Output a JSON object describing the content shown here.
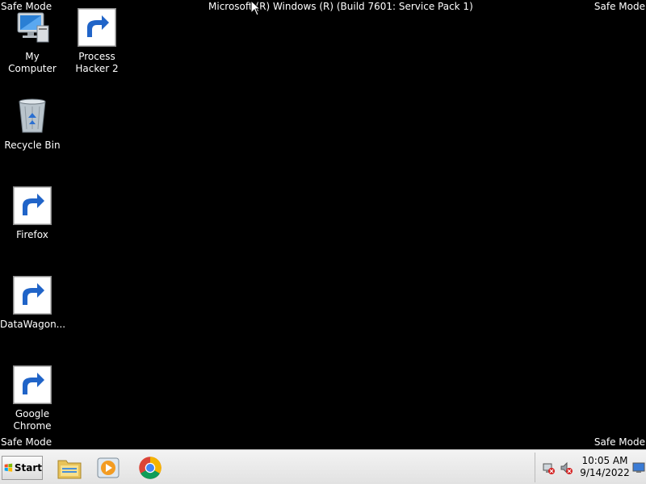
{
  "watermark": {
    "safe_mode": "Safe Mode",
    "build": "Microsoft (R) Windows (R) (Build 7601: Service Pack 1)"
  },
  "desktop": {
    "icons": [
      {
        "name": "my-computer",
        "label": "My Computer"
      },
      {
        "name": "process-hacker",
        "label": "Process Hacker 2"
      },
      {
        "name": "recycle-bin",
        "label": "Recycle Bin"
      },
      {
        "name": "firefox",
        "label": "Firefox"
      },
      {
        "name": "datawagon",
        "label": "DataWagon..."
      },
      {
        "name": "google-chrome",
        "label": "Google Chrome"
      }
    ]
  },
  "taskbar": {
    "start_label": "Start",
    "pinned": [
      "windows-explorer",
      "windows-media-player",
      "google-chrome"
    ],
    "clock_time": "10:05 AM",
    "clock_date": "9/14/2022"
  },
  "colors": {
    "desktop_bg": "#000000",
    "taskbar_bg": "#e8e8e8",
    "text": "#ffffff"
  }
}
